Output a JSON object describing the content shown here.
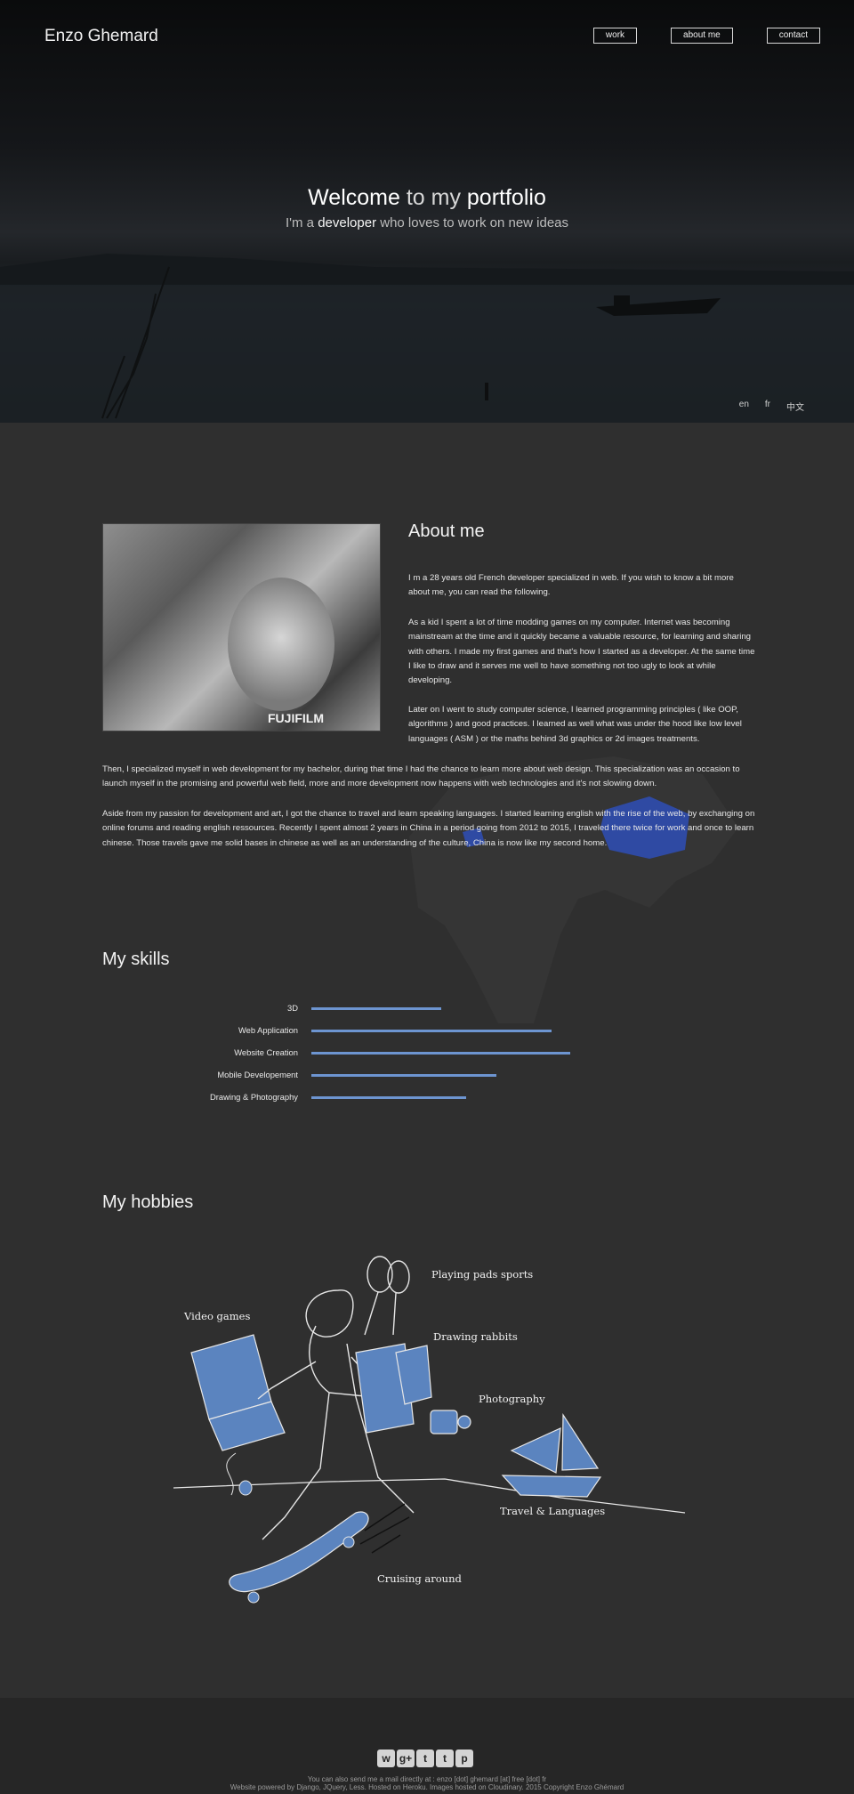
{
  "header": {
    "brand": "Enzo Ghemard",
    "nav": [
      "work",
      "about me",
      "contact"
    ]
  },
  "hero": {
    "title_a": "Welcome",
    "title_b": " to my ",
    "title_c": "portfolio",
    "sub_a": "I'm a ",
    "sub_b": "developer",
    "sub_c": " who loves to work on new ideas",
    "langs": [
      "en",
      "fr",
      "中文"
    ]
  },
  "about": {
    "heading": "About me",
    "photo_tag": "FUJIFILM",
    "paragraphs": [
      "I m a 28 years old French developer specialized in web. If you wish to know a bit more about me, you can read the following.",
      "As a kid I spent a lot of time modding games on my computer. Internet was becoming mainstream at the time and it quickly became a valuable resource, for learning and sharing with others. I made my first games and that's how I started as a developer. At the same time I like to draw and it serves me well to have something not too ugly to look at while developing.",
      "Later on I went to study computer science, I learned programming principles ( like OOP, algorithms ) and good practices. I learned as well what was under the hood like low level languages ( ASM ) or the maths behind 3d graphics or 2d images treatments.",
      "Then, I specialized myself in web development for my bachelor, during that time I had the chance to learn more about web design. This specialization was an occasion to launch myself in the promising and powerful web field, more and more development now happens with web technologies and it's not slowing down.",
      "Aside from my passion for development and art, I got the chance to travel and learn speaking languages. I started learning english with the rise of the web, by exchanging on online forums and reading english ressources. Recently I spent almost 2 years in China in a period going from 2012 to 2015, I traveled there twice for work and once to learn chinese. Those travels gave me solid bases in chinese as well as an understanding of the culture, China is now like my second home."
    ]
  },
  "skills": {
    "heading": "My skills",
    "items": [
      {
        "label": "3D",
        "level": 0.47
      },
      {
        "label": "Web Application",
        "level": 0.87
      },
      {
        "label": "Website Creation",
        "level": 0.94
      },
      {
        "label": "Mobile Developement",
        "level": 0.67
      },
      {
        "label": "Drawing & Photography",
        "level": 0.56
      }
    ],
    "bar_color": "#6d95d1"
  },
  "hobbies": {
    "heading": "My hobbies",
    "labels": [
      "Playing pads sports",
      "Video games",
      "Drawing rabbits",
      "Photography",
      "Travel & Languages",
      "Cruising around"
    ],
    "accent_color": "#5b84bf"
  },
  "footer": {
    "social_icons": [
      "wechat-icon",
      "google-plus-icon",
      "tumblr-icon",
      "twitter-icon",
      "pinterest-icon"
    ],
    "social_glyphs": [
      "w",
      "g+",
      "t",
      "t",
      "p"
    ],
    "mail_line": "You can also send me a mail directly at : enzo [dot] ghemard [at] free [dot] fr",
    "powered_line": "Website powered by Django, JQuery, Less. Hosted on Heroku. Images hosted on Cloudinary. 2015 Copyright Enzo Ghémard"
  }
}
